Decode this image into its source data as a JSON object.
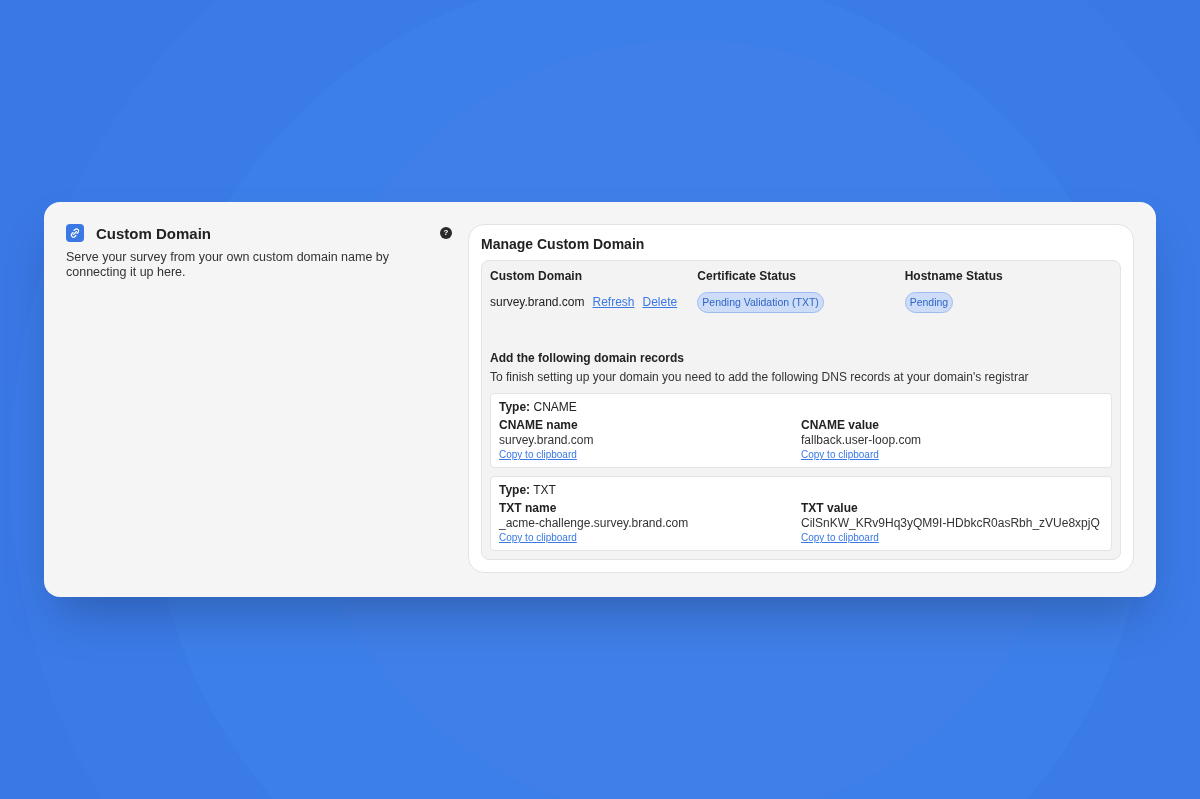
{
  "section": {
    "title": "Custom Domain",
    "description": "Serve your survey from your own custom domain name by connecting it up here.",
    "help": "?"
  },
  "manager": {
    "title": "Manage Custom Domain",
    "columns": [
      "Custom Domain",
      "Certificate Status",
      "Hostname Status"
    ],
    "domain": "survey.brand.com",
    "actions": [
      "Refresh",
      "Delete"
    ],
    "certificate_status": "Pending Validation (TXT)",
    "hostname_status": "Pending",
    "records_title": "Add the following domain records",
    "records_hint": "To finish setting up your domain you need to add the following DNS records at your domain's registrar",
    "records": [
      {
        "type": "**Type:** CNAME",
        "fields": [
          {
            "label": "CNAME name",
            "value": "survey.brand.com",
            "copy": "Copy to clipboard"
          },
          {
            "label": "CNAME value",
            "value": "fallback.user-loop.com",
            "copy": "Copy to clipboard"
          }
        ]
      },
      {
        "type": "**Type:** TXT",
        "fields": [
          {
            "label": "TXT name",
            "value": "_acme-challenge.survey.brand.com",
            "copy": "Copy to clipboard"
          },
          {
            "label": "TXT value",
            "value": "CilSnKW_KRv9Hq3yQM9I-HDbkcR0asRbh_zVUe8xpjQ",
            "copy": "Copy to clipboard"
          }
        ]
      }
    ]
  }
}
